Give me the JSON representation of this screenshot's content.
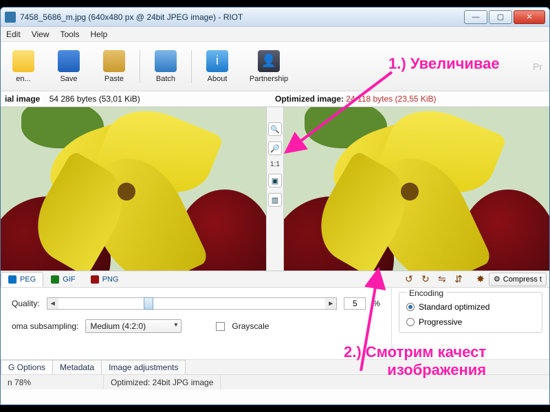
{
  "window": {
    "title": "7458_5686_m.jpg (640x480 px @ 24bit JPEG image) - RIOT"
  },
  "menu": {
    "items": [
      "Edit",
      "View",
      "Tools",
      "Help"
    ]
  },
  "toolbar": {
    "open": "en...",
    "save": "Save",
    "paste": "Paste",
    "batch": "Batch",
    "about": "About",
    "partnership": "Partnership",
    "right_hint": "Pr"
  },
  "info": {
    "left_label": "ial image",
    "left_bytes": "54 286 bytes (53,01 KiB)",
    "right_label": "Optimized image:",
    "right_bytes": "24 118 bytes (23,55 KiB)"
  },
  "midtools": {
    "fit_label": "1:1"
  },
  "format_tabs": {
    "jpeg": "PEG",
    "gif": "GIF",
    "png": "PNG"
  },
  "right_tools": {
    "compress": "Compress t"
  },
  "settings": {
    "quality_label": "Quality:",
    "quality_value": "5",
    "quality_percent": "%",
    "chroma_label": "oma subsampling:",
    "chroma_value": "Medium (4:2:0)",
    "grayscale": "Grayscale",
    "encoding_title": "Encoding",
    "enc_standard": "Standard optimized",
    "enc_progressive": "Progressive"
  },
  "bottom_tabs": {
    "options": "G Options",
    "metadata": "Metadata",
    "adjust": "Image adjustments"
  },
  "status": {
    "zoom": "n 78%",
    "opt": "Optimized: 24bit JPG image"
  },
  "annotations": {
    "a1": "1.) Увеличивае",
    "a2_l1": "2.) Смотрим качест",
    "a2_l2": "изображения"
  },
  "colors": {
    "accent_pink": "#ff1caa",
    "opt_red": "#c02a2a",
    "link_blue": "#0b4b85"
  }
}
